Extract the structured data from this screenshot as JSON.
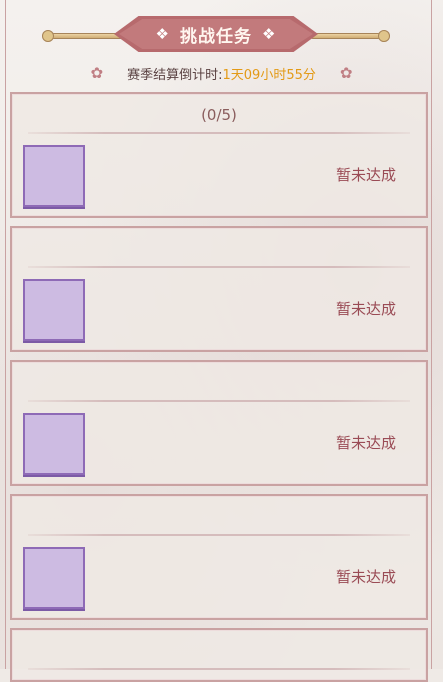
{
  "header": {
    "title": "挑战任务",
    "ornament_left": "❖",
    "ornament_right": "❖"
  },
  "countdown": {
    "label": "赛季结算倒计时:",
    "value": "1天09小时55分",
    "flower_left": "✿",
    "flower_right": "✿"
  },
  "tasks": [
    {
      "progress": "(0/5)",
      "status": "暂未达成",
      "icon": "task-reward-placeholder"
    },
    {
      "progress": "",
      "status": "暂未达成",
      "icon": "task-reward-placeholder"
    },
    {
      "progress": "",
      "status": "暂未达成",
      "icon": "task-reward-placeholder"
    },
    {
      "progress": "",
      "status": "暂未达成",
      "icon": "task-reward-placeholder"
    },
    {
      "progress": "",
      "status": "",
      "icon": ""
    }
  ],
  "colors": {
    "accent": "#b76a6d",
    "countdown_value": "#e39a16",
    "status_text": "#9a4b55",
    "icon_fill": "#cdbbe2"
  }
}
